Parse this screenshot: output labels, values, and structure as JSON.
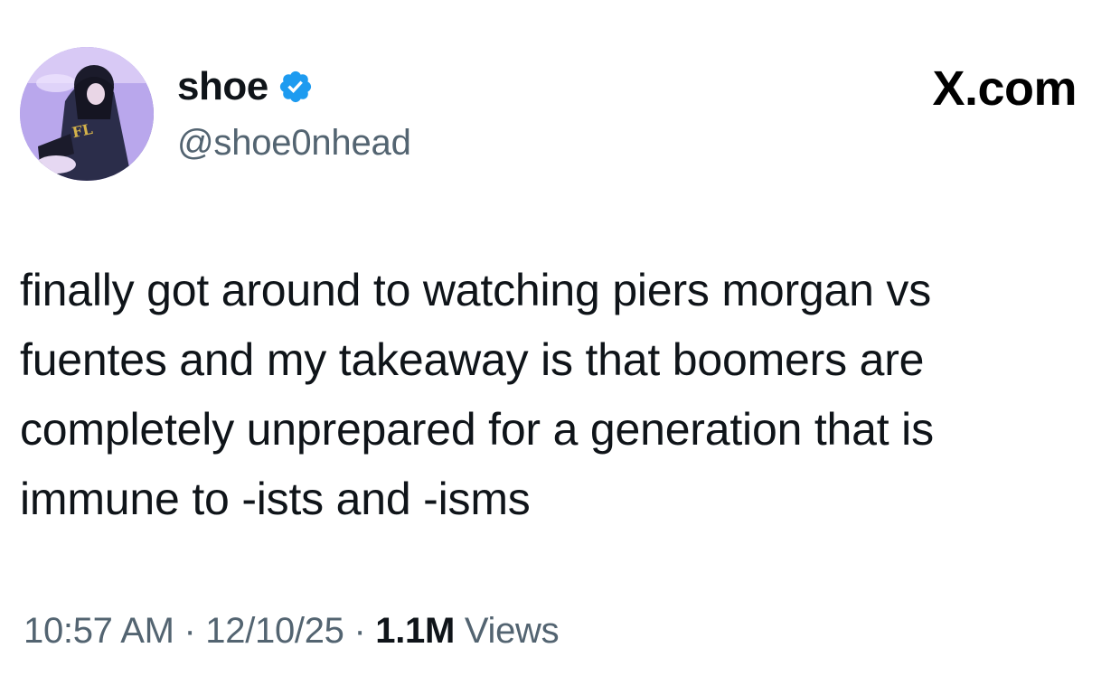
{
  "author": {
    "display_name": "shoe",
    "handle": "@shoe0nhead",
    "verified": true,
    "verified_badge_color": "#1d9bf0"
  },
  "brand": {
    "label": "X.com"
  },
  "tweet": {
    "lines": [
      "finally got around to watching piers morgan vs",
      "fuentes and my takeaway is that boomers are",
      "completely unprepared for a generation that is",
      "immune to -ists and -isms"
    ]
  },
  "meta": {
    "time": "10:57 AM",
    "separator": "·",
    "date": "12/10/25",
    "views_count": "1.1M",
    "views_label": "Views"
  },
  "icons": {
    "avatar": "avatar-image",
    "verified": "verified-badge-icon"
  }
}
